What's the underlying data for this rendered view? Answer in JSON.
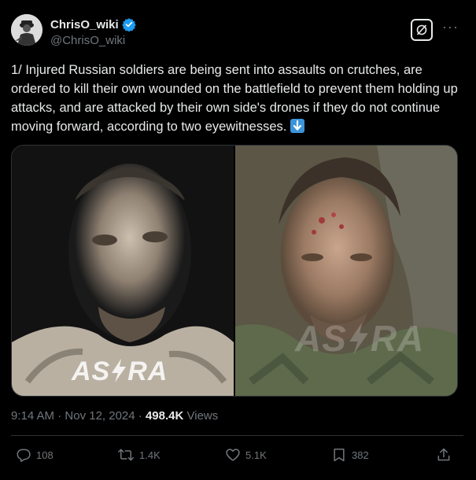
{
  "author": {
    "display_name": "ChrisO_wiki",
    "handle": "@ChrisO_wiki",
    "verified_color": "#1d9bf0"
  },
  "tweet": {
    "text": "1/ Injured Russian soldiers are being sent into assaults on crutches, are ordered to kill their own wounded on the battlefield to prevent them holding up attacks, and are attacked by their own side's drones if they do not continue moving forward, according to two eyewitnesses.",
    "emoji": "down-arrow-emoji"
  },
  "media": {
    "left_watermark": "AS",
    "left_watermark_2": "RA",
    "right_watermark": "AS",
    "right_watermark_2": "RA"
  },
  "meta": {
    "time": "9:14 AM",
    "separator": " · ",
    "date": "Nov 12, 2024",
    "views_count": "498.4K",
    "views_label": " Views"
  },
  "actions": {
    "replies": "108",
    "reposts": "1.4K",
    "likes": "5.1K",
    "bookmarks": "382"
  },
  "icons": [
    "reply-icon",
    "repost-icon",
    "like-icon",
    "bookmark-icon",
    "share-icon",
    "grok-icon",
    "more-icon",
    "verified-badge-icon"
  ]
}
